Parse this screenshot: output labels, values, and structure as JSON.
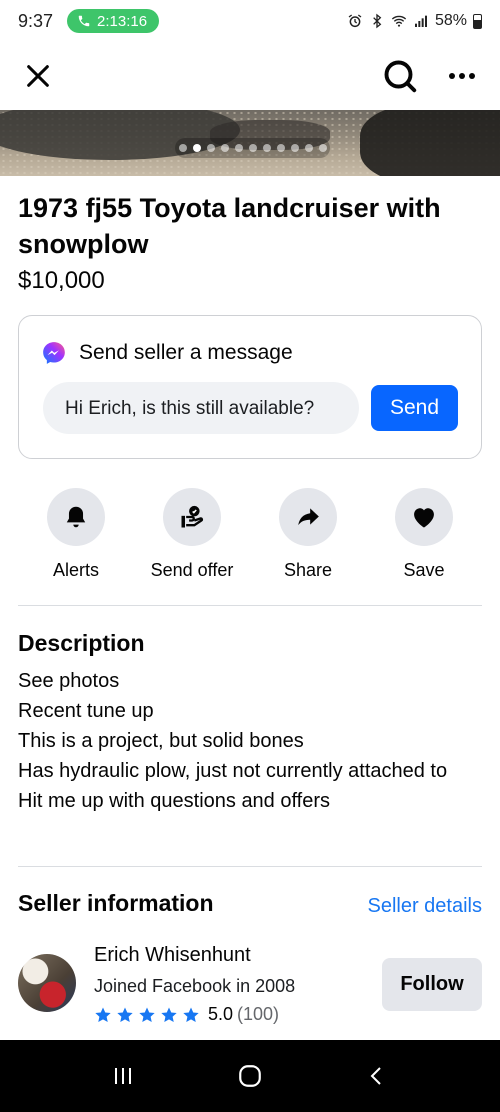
{
  "status_bar": {
    "time": "9:37",
    "call_timer": "2:13:16",
    "battery": "58%"
  },
  "listing": {
    "title": "1973 fj55 Toyota landcruiser with snowplow",
    "price": "$10,000",
    "photo_count": 11,
    "active_photo": 1
  },
  "message": {
    "heading": "Send seller a message",
    "input_value": "Hi Erich, is this still available?",
    "send_label": "Send"
  },
  "actions": [
    {
      "label": "Alerts",
      "icon": "bell-icon"
    },
    {
      "label": "Send offer",
      "icon": "offer-icon"
    },
    {
      "label": "Share",
      "icon": "share-icon"
    },
    {
      "label": "Save",
      "icon": "heart-icon"
    }
  ],
  "description": {
    "heading": "Description",
    "lines": [
      "See photos",
      "Recent tune up",
      "This is a project, but solid bones",
      "Has hydraulic plow, just not currently attached to",
      "Hit me up with questions and offers"
    ]
  },
  "seller": {
    "heading": "Seller information",
    "details_link": "Seller details",
    "name": "Erich Whisenhunt",
    "joined": "Joined Facebook in 2008",
    "rating_value": "5.0",
    "rating_count": "(100)",
    "stars": 5,
    "follow_label": "Follow"
  },
  "colors": {
    "accent": "#0866ff",
    "link": "#1877f2",
    "star": "#1877f2",
    "call_pill": "#3ec56a"
  }
}
